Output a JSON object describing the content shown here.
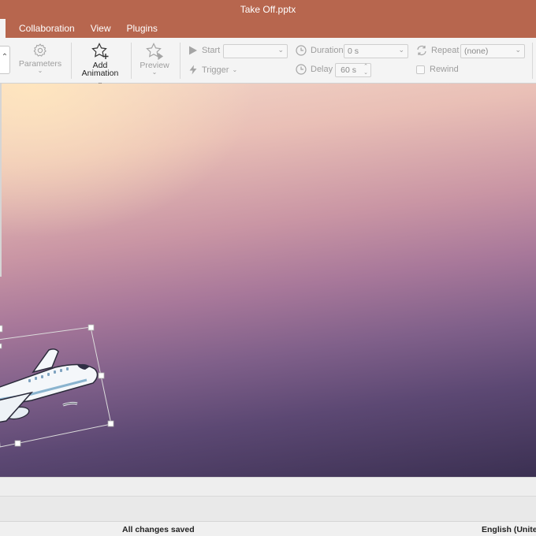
{
  "window": {
    "title": "Take Off.pptx"
  },
  "menu": {
    "tabs": [
      {
        "label": "Collaboration"
      },
      {
        "label": "View"
      },
      {
        "label": "Plugins"
      }
    ]
  },
  "ribbon": {
    "parameters_label": "Parameters",
    "add_animation_line1": "Add",
    "add_animation_line2": "Animation",
    "preview_label": "Preview",
    "start_label": "Start",
    "start_value": "",
    "trigger_label": "Trigger",
    "duration_label": "Duration",
    "duration_value": "0 s",
    "delay_label": "Delay",
    "delay_value": "60 s",
    "repeat_label": "Repeat",
    "repeat_value": "(none)",
    "rewind_label": "Rewind",
    "rewind_checked": false
  },
  "status": {
    "save_state": "All changes saved",
    "language": "English (United"
  },
  "icons": {
    "parameters": "gear-icon",
    "add_animation": "star-plus-icon",
    "preview": "star-play-icon",
    "start": "play-icon",
    "trigger": "lightning-icon",
    "duration": "clock-icon",
    "delay": "clock-icon",
    "repeat": "repeat-icon"
  },
  "colors": {
    "titlebar": "#b7664e",
    "ribbon": "#f4f4f4"
  }
}
